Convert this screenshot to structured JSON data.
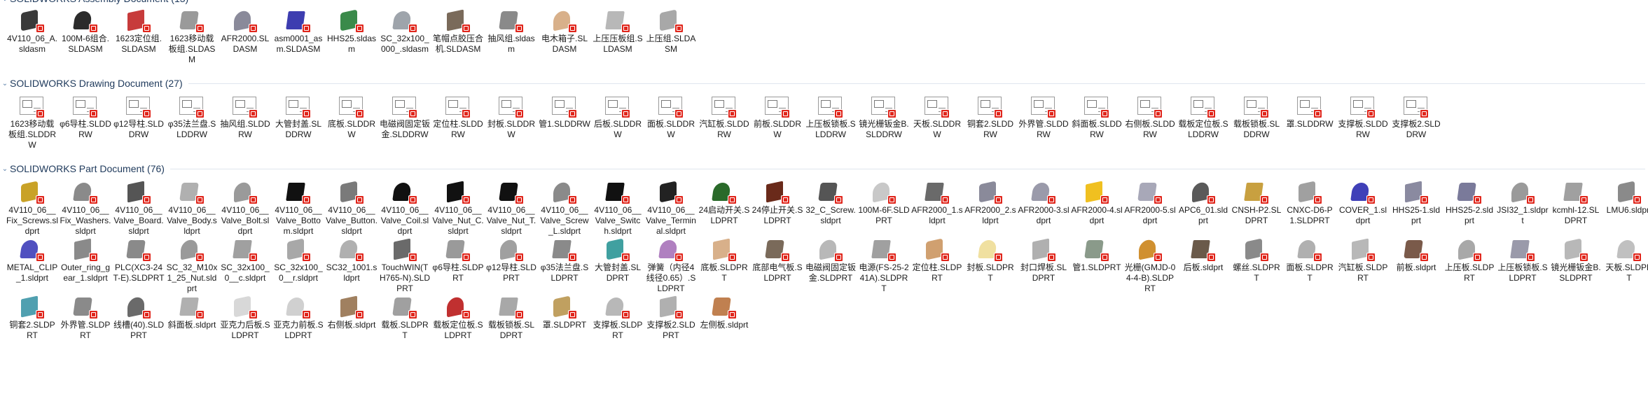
{
  "groups": [
    {
      "title": "SOLIDWORKS Assembly Document (13)",
      "type": "assembly",
      "items": [
        {
          "label": "4V110_06_A.sldasm",
          "color": "#3a3a3a"
        },
        {
          "label": "100M-6组合.SLDASM",
          "color": "#2b2b2b"
        },
        {
          "label": "1623定位组.SLDASM",
          "color": "#c73b3b"
        },
        {
          "label": "1623移动载板组.SLDASM",
          "color": "#9a9a9a"
        },
        {
          "label": "AFR2000.SLDASM",
          "color": "#8a8a9a"
        },
        {
          "label": "asm0001_asm.SLDASM",
          "color": "#3d3db0"
        },
        {
          "label": "HHS25.sldasm",
          "color": "#3a8a4a"
        },
        {
          "label": "SC_32x100_000_.sldasm",
          "color": "#9ea4ab"
        },
        {
          "label": "笔帽点胶压合机.SLDASM",
          "color": "#7a6a5a"
        },
        {
          "label": "抽风组.sldasm",
          "color": "#8a8a8a"
        },
        {
          "label": "电木箱子.SLDASM",
          "color": "#d8b08a"
        },
        {
          "label": "上压压板组.SLDASM",
          "color": "#b8b8b8"
        },
        {
          "label": "上压组.SLDASM",
          "color": "#a8a8a8"
        }
      ]
    },
    {
      "title": "SOLIDWORKS Drawing Document (27)",
      "type": "drawing",
      "items": [
        {
          "label": "1623移动载板组.SLDDRW"
        },
        {
          "label": "φ6导柱.SLDDRW"
        },
        {
          "label": "φ12导柱.SLDDRW"
        },
        {
          "label": "φ35法兰盘.SLDDRW"
        },
        {
          "label": "抽风组.SLDDRW"
        },
        {
          "label": "大管封盖.SLDDRW"
        },
        {
          "label": "底板.SLDDRW"
        },
        {
          "label": "电磁阀固定钣金.SLDDRW"
        },
        {
          "label": "定位柱.SLDDRW"
        },
        {
          "label": "封板.SLDDRW"
        },
        {
          "label": "管1.SLDDRW"
        },
        {
          "label": "后板.SLDDRW"
        },
        {
          "label": "面板.SLDDRW"
        },
        {
          "label": "汽缸板.SLDDRW"
        },
        {
          "label": "前板.SLDDRW"
        },
        {
          "label": "上压板锁板.SLDDRW"
        },
        {
          "label": "镜光栅钣金B.SLDDRW"
        },
        {
          "label": "天板.SLDDRW"
        },
        {
          "label": "铜套2.SLDDRW"
        },
        {
          "label": "外界管.SLDDRW"
        },
        {
          "label": "斜面板.SLDDRW"
        },
        {
          "label": "右侧板.SLDDRW"
        },
        {
          "label": "载板定位板.SLDDRW"
        },
        {
          "label": "载板锁板.SLDDRW"
        },
        {
          "label": "罩.SLDDRW"
        },
        {
          "label": "支撑板.SLDDRW"
        },
        {
          "label": "支撑板2.SLDDRW"
        }
      ]
    },
    {
      "title": "SOLIDWORKS Part Document (76)",
      "type": "part",
      "items": [
        {
          "label": "4V110_06__Fix_Screws.sldprt",
          "color": "#c9a227"
        },
        {
          "label": "4V110_06__Fix_Washers.sldprt",
          "color": "#8a8a8a"
        },
        {
          "label": "4V110_06__Valve_Board.sldprt",
          "color": "#555555"
        },
        {
          "label": "4V110_06__Valve_Body.sldprt",
          "color": "#b0b0b0"
        },
        {
          "label": "4V110_06__Valve_Bolt.sldprt",
          "color": "#9a9a9a"
        },
        {
          "label": "4V110_06__Valve_Bottom.sldprt",
          "color": "#111111"
        },
        {
          "label": "4V110_06__Valve_Button.sldprt",
          "color": "#7a7a7a"
        },
        {
          "label": "4V110_06__Valve_Coil.sldprt",
          "color": "#111111"
        },
        {
          "label": "4V110_06__Valve_Nut_C.sldprt",
          "color": "#111111"
        },
        {
          "label": "4V110_06__Valve_Nut_T.sldprt",
          "color": "#111111"
        },
        {
          "label": "4V110_06__Valve_Screw_L.sldprt",
          "color": "#8a8a8a"
        },
        {
          "label": "4V110_06__Valve_Switch.sldprt",
          "color": "#111111"
        },
        {
          "label": "4V110_06__Valve_Terminal.sldprt",
          "color": "#222222"
        },
        {
          "label": "24启动开关.SLDPRT",
          "color": "#2a6a2a"
        },
        {
          "label": "24停止开关.SLDPRT",
          "color": "#6a2a1a"
        },
        {
          "label": "32_C_Screw.sldprt",
          "color": "#555555"
        },
        {
          "label": "100M-6F.SLDPRT",
          "color": "#c8c8c8"
        },
        {
          "label": "AFR2000_1.sldprt",
          "color": "#6a6a6a"
        },
        {
          "label": "AFR2000_2.sldprt",
          "color": "#8a8a9a"
        },
        {
          "label": "AFR2000-3.sldprt",
          "color": "#9a9aaa"
        },
        {
          "label": "AFR2000-4.sldprt",
          "color": "#f0c020"
        },
        {
          "label": "AFR2000-5.sldprt",
          "color": "#a8a8b8"
        },
        {
          "label": "APC6_01.sldprt",
          "color": "#5a5a5a"
        },
        {
          "label": "CNSH-P2.SLDPRT",
          "color": "#c8a040"
        },
        {
          "label": "CNXC-D6-P1.SLDPRT",
          "color": "#a0a0a0"
        },
        {
          "label": "COVER_1.sldprt",
          "color": "#4040b8"
        },
        {
          "label": "HHS25-1.sldprt",
          "color": "#8a8aa0"
        },
        {
          "label": "HHS25-2.sldprt",
          "color": "#7a7a9a"
        },
        {
          "label": "JSI32_1.sldprt",
          "color": "#9a9a9a"
        },
        {
          "label": "kcmhl-12.SLDPRT",
          "color": "#a0a0a0"
        },
        {
          "label": "LMU6.sldprt",
          "color": "#8a8a8a"
        },
        {
          "label": "METAL_CLIP_1.sldprt",
          "color": "#5050c0"
        },
        {
          "label": "Outer_ring_gear_1.sldprt",
          "color": "#8a8a8a"
        },
        {
          "label": "PLC(XC3-24T-E).SLDPRT",
          "color": "#8a8a8a"
        },
        {
          "label": "SC_32_M10x1_25_Nut.sldprt",
          "color": "#9a9a9a"
        },
        {
          "label": "SC_32x100_0__c.sldprt",
          "color": "#a0a0a0"
        },
        {
          "label": "SC_32x100_0__r.sldprt",
          "color": "#a8a8a8"
        },
        {
          "label": "SC32_1001.sldprt",
          "color": "#b0b0b0"
        },
        {
          "label": "TouchWIN(TH765-N).SLDPRT",
          "color": "#6a6a6a"
        },
        {
          "label": "φ6导柱.SLDPRT",
          "color": "#9a9a9a"
        },
        {
          "label": "φ12导柱.SLDPRT",
          "color": "#a0a0a0"
        },
        {
          "label": "φ35法兰盘.SLDPRT",
          "color": "#8a8a8a"
        },
        {
          "label": "大管封盖.SLDPRT",
          "color": "#40a0a0"
        },
        {
          "label": "弹簧（内径4线径0.65）.SLDPRT",
          "color": "#b080c0"
        },
        {
          "label": "底板.SLDPRT",
          "color": "#d8b08a"
        },
        {
          "label": "底部电气板.SLDPRT",
          "color": "#7a6a5a"
        },
        {
          "label": "电磁阀固定钣金.SLDPRT",
          "color": "#b8b8b8"
        },
        {
          "label": "电源(FS-25-241A).SLDPRT",
          "color": "#a0a0a0"
        },
        {
          "label": "定位柱.SLDPRT",
          "color": "#d0a070"
        },
        {
          "label": "封板.SLDPRT",
          "color": "#f0e0a0"
        },
        {
          "label": "封口焊板.SLDPRT",
          "color": "#b0b0b0"
        },
        {
          "label": "管1.SLDPRT",
          "color": "#8a9a8a"
        },
        {
          "label": "光栅(GMJD-04-4-B).SLDPRT",
          "color": "#d09030"
        },
        {
          "label": "后板.sldprt",
          "color": "#6a5a4a"
        },
        {
          "label": "螺丝.SLDPRT",
          "color": "#8a8a8a"
        },
        {
          "label": "面板.SLDPRT",
          "color": "#b0b0b0"
        },
        {
          "label": "汽缸板.SLDPRT",
          "color": "#b8b8b8"
        },
        {
          "label": "前板.sldprt",
          "color": "#7a5a4a"
        },
        {
          "label": "上压板.SLDPRT",
          "color": "#a8a8a8"
        },
        {
          "label": "上压板锁板.SLDPRT",
          "color": "#9a9aaa"
        },
        {
          "label": "镜光栅钣金B.SLDPRT",
          "color": "#b8b8b8"
        },
        {
          "label": "天板.SLDPRT",
          "color": "#c0c0c0"
        },
        {
          "label": "铜套2.SLDPRT",
          "color": "#50a0b0"
        },
        {
          "label": "外界管.SLDPRT",
          "color": "#8a8a8a"
        },
        {
          "label": "线槽(40).SLDPRT",
          "color": "#6a6a6a"
        },
        {
          "label": "斜面板.sldprt",
          "color": "#b0b0b0"
        },
        {
          "label": "亚克力后板.SLDPRT",
          "color": "#d8d8d8"
        },
        {
          "label": "亚克力前板.SLDPRT",
          "color": "#d0d0d0"
        },
        {
          "label": "右侧板.sldprt",
          "color": "#a08060"
        },
        {
          "label": "载板.SLDPRT",
          "color": "#a0a0a0"
        },
        {
          "label": "载板定位板.SLDPRT",
          "color": "#c03030"
        },
        {
          "label": "载板锁板.SLDPRT",
          "color": "#a8a8a8"
        },
        {
          "label": "罩.SLDPRT",
          "color": "#c0a060"
        },
        {
          "label": "支撑板.SLDPRT",
          "color": "#b8b8b8"
        },
        {
          "label": "支撑板2.SLDPRT",
          "color": "#b0b0b0"
        },
        {
          "label": "左侧板.sldprt",
          "color": "#c08050"
        }
      ]
    }
  ],
  "icons": {
    "badge": "solidworks-badge-icon",
    "collapse": "chevron-down-icon"
  }
}
